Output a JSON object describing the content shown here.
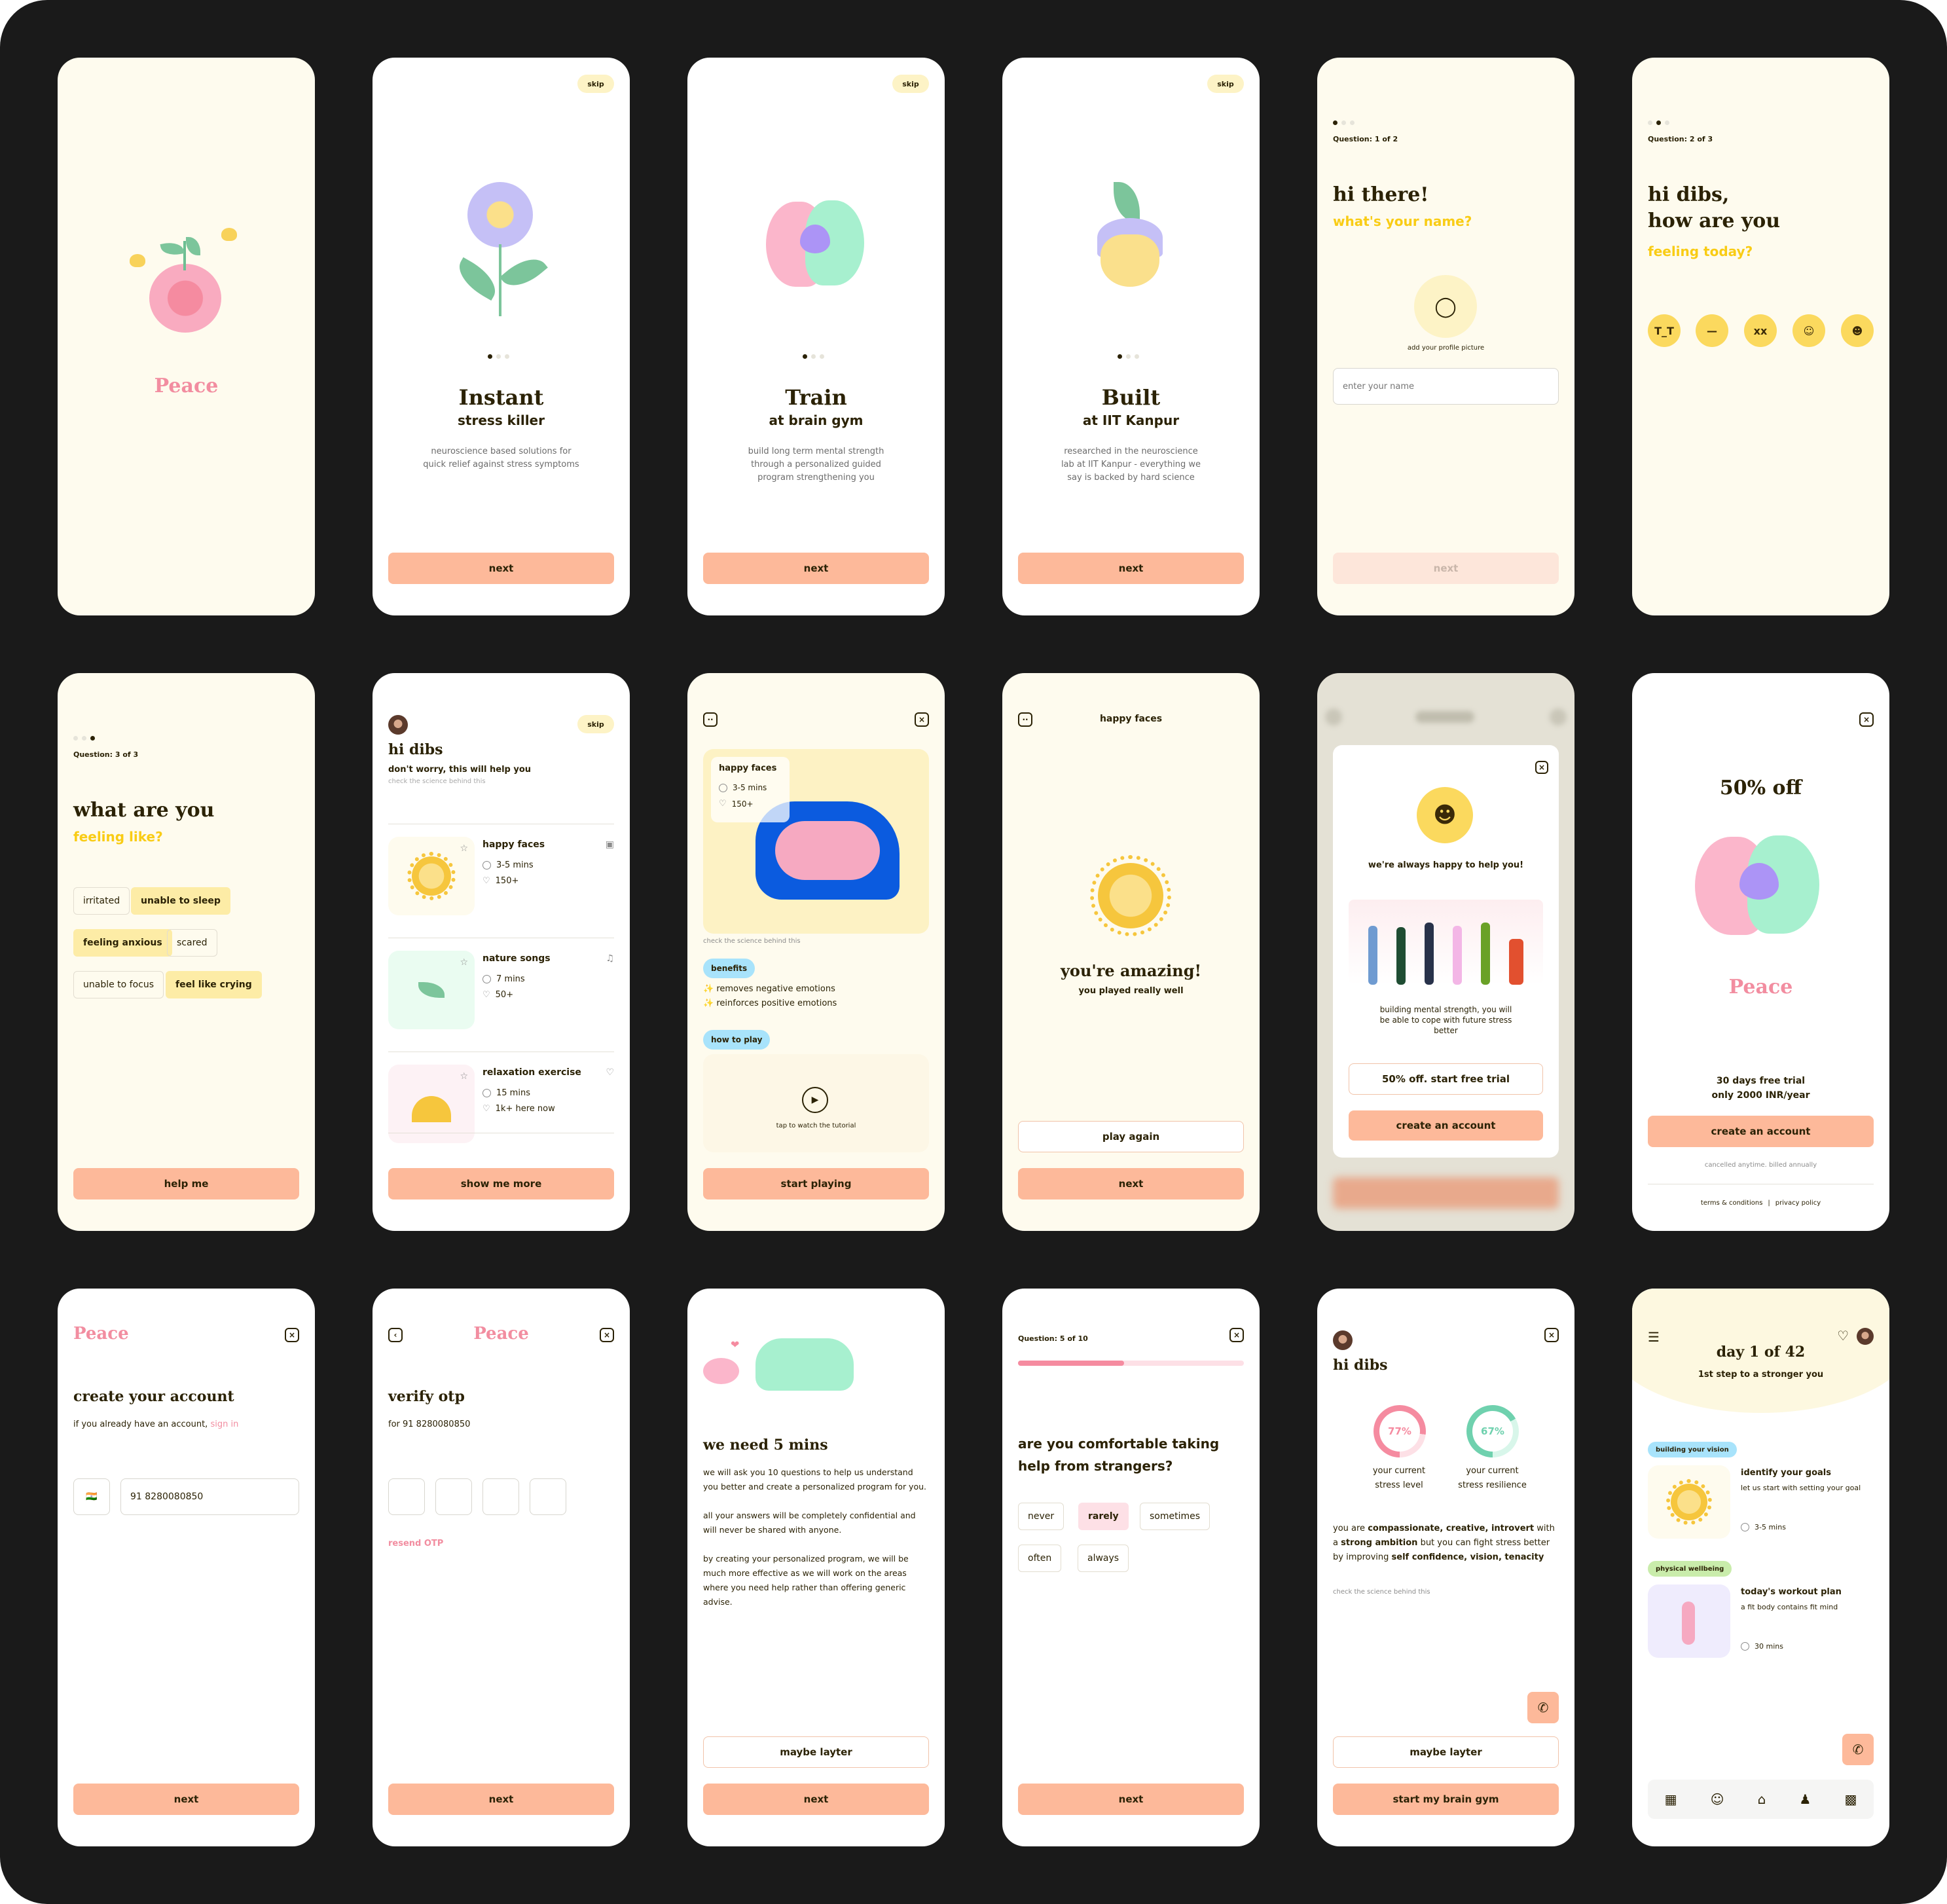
{
  "app": {
    "name": "Peace"
  },
  "colors": {
    "board": "#1a1a1a",
    "cream": "#fefbee",
    "primary_button": "#fdb99a",
    "text_dark": "#2b2205",
    "accent_yellow": "#f9cc15",
    "logo_pink": "#f28da0",
    "chip_selected": "#fdeca6",
    "stress_level": "#f58ba0",
    "stress_resilience": "#6fd1ae"
  },
  "screens": {
    "splash": {
      "logo": "Peace",
      "illustration": "brain-sprout-with-butterflies"
    },
    "onboard1": {
      "skip": "skip",
      "title": "Instant",
      "subtitle": "stress killer",
      "desc_lines": [
        "neuroscience based solutions for",
        "quick relief against stress symptoms"
      ],
      "page": 1,
      "pages": 3,
      "next": "next"
    },
    "onboard2": {
      "skip": "skip",
      "title": "Train",
      "subtitle": "at brain gym",
      "desc_lines": [
        "build long term mental strength",
        "through a personalized guided",
        "program strengthening you"
      ],
      "page": 1,
      "pages": 3,
      "next": "next"
    },
    "onboard3": {
      "skip": "skip",
      "title": "Built",
      "subtitle": "at IIT Kanpur",
      "desc_lines": [
        "researched in the neuroscience",
        "lab at IIT Kanpur - everything we",
        "say is backed by hard science"
      ],
      "page": 1,
      "pages": 3,
      "next": "next"
    },
    "q1": {
      "step": 1,
      "steps": 3,
      "label": "Question: 1 of 2",
      "title": "hi there!",
      "prompt": "what's your name?",
      "avatar_caption": "add your profile picture",
      "name_placeholder": "enter your name",
      "next": "next"
    },
    "q2": {
      "step": 2,
      "steps": 3,
      "label": "Question: 2 of 3",
      "title_lines": [
        "hi dibs,",
        "how are you"
      ],
      "prompt": "feeling today?",
      "moods": [
        "crying",
        "sad",
        "dizzy",
        "smile",
        "happy"
      ]
    },
    "q3": {
      "step": 3,
      "steps": 3,
      "label": "Question: 3 of 3",
      "title": "what are you",
      "prompt": "feeling like?",
      "options": [
        {
          "label": "irritated",
          "selected": false
        },
        {
          "label": "unable to sleep",
          "selected": true
        },
        {
          "label": "feeling anxious",
          "selected": true
        },
        {
          "label": "scared",
          "selected": false
        },
        {
          "label": "unable to focus",
          "selected": false
        },
        {
          "label": "feel like crying",
          "selected": true
        }
      ],
      "cta": "help me"
    },
    "recommend": {
      "skip": "skip",
      "title": "hi dibs",
      "subtitle": "don't worry, this will help you",
      "science_link": "check the science behind this",
      "items": [
        {
          "name": "happy faces",
          "duration": "3-5 mins",
          "likes": "150+",
          "type_icon": "game-icon"
        },
        {
          "name": "nature songs",
          "duration": "7 mins",
          "likes": "50+",
          "type_icon": "music-note-icon"
        },
        {
          "name": "relaxation exercise",
          "duration": "15 mins",
          "likes": "1k+ here now",
          "type_icon": "hearts-icon"
        }
      ],
      "cta": "show me more"
    },
    "game_detail": {
      "card_title": "happy faces",
      "duration": "3-5 mins",
      "likes": "150+",
      "science_link": "check the science behind this",
      "benefits_label": "benefits",
      "benefits": [
        "removes negative emotions",
        "reinforces positive emotions"
      ],
      "how_to_label": "how to play",
      "tutorial_caption": "tap to watch the tutorial",
      "cta": "start playing"
    },
    "game_done": {
      "header": "happy faces",
      "title": "you're amazing!",
      "subtitle": "you played really well",
      "secondary": "play again",
      "primary": "next"
    },
    "modal": {
      "title": "we're always happy to help you!",
      "desc_lines": [
        "building mental strength, you will",
        "be able to cope with future stress",
        "better"
      ],
      "secondary": "50% off. start free trial",
      "primary": "create an account"
    },
    "offer": {
      "title": "50% off",
      "logo": "Peace",
      "line1": "30 days free trial",
      "line2": "only 2000 INR/year",
      "cta": "create an account",
      "fine_print": "cancelled anytime. billed annually",
      "terms": "terms & conditions",
      "separator": "|",
      "privacy": "privacy policy"
    },
    "create_account": {
      "logo": "Peace",
      "title": "create your account",
      "signin_prefix": "if you already have an account,",
      "signin_link": "sign in",
      "country_flag": "🇮🇳",
      "phone_value": "91 8280080850",
      "cta": "next"
    },
    "verify_otp": {
      "logo": "Peace",
      "title": "verify otp",
      "for_text": "for 91 8280080850",
      "otp_digits": [
        "",
        "",
        "",
        ""
      ],
      "resend": "resend OTP",
      "cta": "next"
    },
    "need5": {
      "title": "we need 5 mins",
      "paragraphs": [
        "we will ask you 10 questions to help us understand you better and create a personalized program for you.",
        "all your answers will be completely confidential and will never be shared with anyone.",
        "by creating your personalized program, we will be much more effective as we will work on the areas where you need help rather than offering generic advise."
      ],
      "secondary": "maybe layter",
      "primary": "next"
    },
    "q5": {
      "label": "Question: 5 of 10",
      "progress": 0.47,
      "question": "are you comfortable taking help from strangers?",
      "options": [
        {
          "label": "never",
          "selected": false
        },
        {
          "label": "rarely",
          "selected": true
        },
        {
          "label": "sometimes",
          "selected": false
        },
        {
          "label": "often",
          "selected": false
        },
        {
          "label": "always",
          "selected": false
        }
      ],
      "cta": "next"
    },
    "result": {
      "title": "hi dibs",
      "stress_level": {
        "value": 77,
        "label_lines": [
          "your current",
          "stress level"
        ],
        "display": "77%"
      },
      "stress_resilience": {
        "value": 67,
        "label_lines": [
          "your current",
          "stress resilience"
        ],
        "display": "67%"
      },
      "summary_parts": [
        {
          "t": "you are ",
          "b": false
        },
        {
          "t": "compassionate, creative, introvert",
          "b": true
        },
        {
          "t": " with a ",
          "b": false
        },
        {
          "t": "strong ambition",
          "b": true
        },
        {
          "t": " but you can fight stress better by improving ",
          "b": false
        },
        {
          "t": "self confidence, vision, tenacity",
          "b": true
        }
      ],
      "science_link": "check the science behind this",
      "secondary": "maybe layter",
      "primary": "start my brain gym"
    },
    "home": {
      "title": "day 1 of 42",
      "subtitle": "1st step to a stronger you",
      "sections": [
        {
          "tag": "building your vision",
          "tag_color": "#a8e3fb",
          "title": "identify your goals",
          "desc": "let us start with setting your goal",
          "duration": "3-5 mins"
        },
        {
          "tag": "physical wellbeing",
          "tag_color": "#c9ecab",
          "title": "today's workout plan",
          "desc": "a fit body contains fit mind",
          "duration": "30 mins"
        }
      ],
      "nav": [
        "add-widget-icon",
        "mood-face-icon",
        "home-icon",
        "community-icon",
        "stats-icon"
      ]
    }
  }
}
